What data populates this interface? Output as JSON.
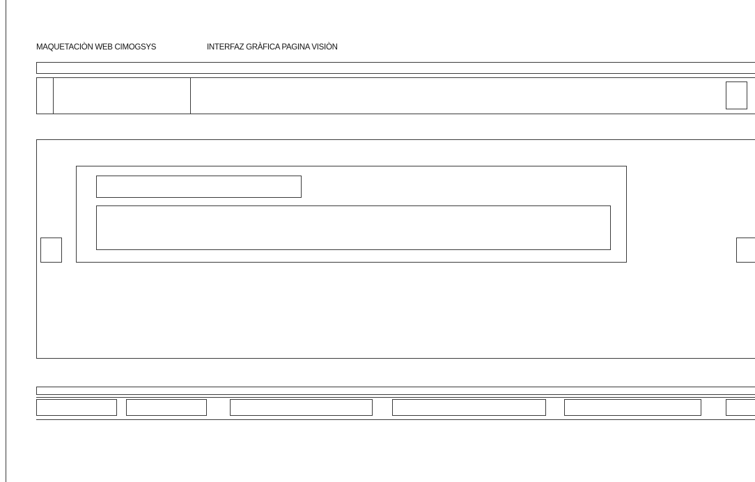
{
  "titles": {
    "left": "MAQUETACIÒN WEB CIMOGSYS",
    "right": "INTERFAZ GRÀFICA PAGINA VISIÒN"
  }
}
